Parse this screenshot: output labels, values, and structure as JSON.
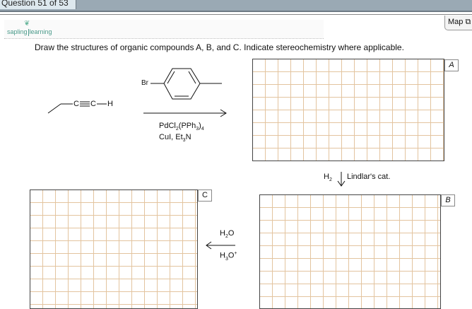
{
  "header": {
    "tab_label": "Question 51 of 53",
    "map_label": "Map"
  },
  "logo": {
    "left": "sapling",
    "right": "learning"
  },
  "question": {
    "text": "Draw the structures of organic compounds A, B, and C. Indicate stereochemistry where applicable."
  },
  "scheme": {
    "alkyne_c1": "C",
    "alkyne_c2": "C",
    "alkyne_h": "H",
    "br": "Br",
    "reagent1_line1": "PdCl2(PPh3)4",
    "reagent1_line2": "CuI, Et3N",
    "reagent2_left": "H2",
    "reagent2_right": "Lindlar's cat.",
    "reagent3_top": "H2O",
    "reagent3_bottom": "H3O+"
  },
  "boxes": {
    "a": "A",
    "b": "B",
    "c": "C"
  },
  "colors": {
    "grid": "#e3c49f",
    "topbar": "#9aa9b4",
    "tab": "#dde8ee"
  }
}
